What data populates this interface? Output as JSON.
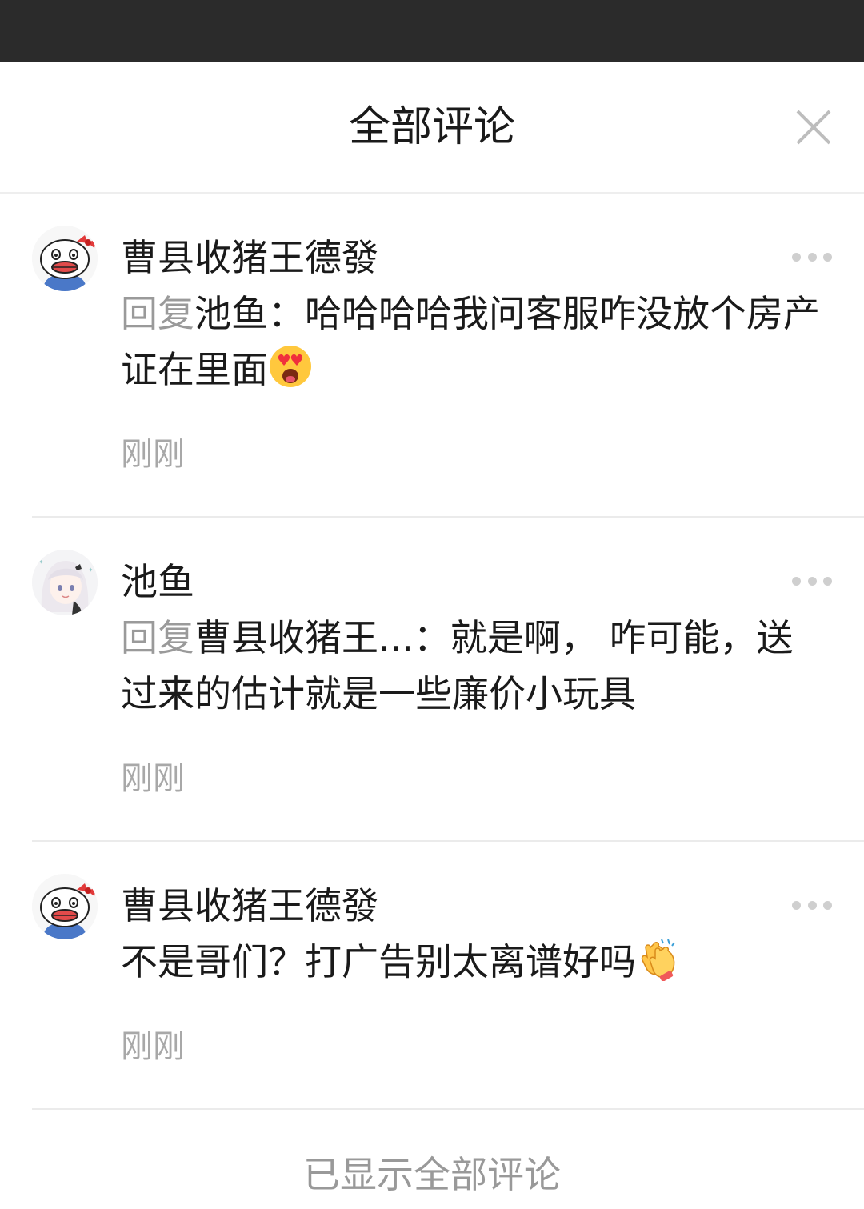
{
  "header": {
    "title": "全部评论",
    "close_icon": "close-icon"
  },
  "comments": [
    {
      "author": "曹县收猪王德發",
      "avatar": "hello-kitty-avatar",
      "reply_label": "回复",
      "reply_to": "池鱼",
      "separator": "：",
      "text": "哈哈哈哈我问客服咋没放个房产证在里面",
      "emoji": "heart-eyes-emoji",
      "time": "刚刚",
      "more_icon": "more-dots-icon"
    },
    {
      "author": "池鱼",
      "avatar": "anime-girl-avatar",
      "reply_label": "回复",
      "reply_to": "曹县收猪王...",
      "separator": "：",
      "text": "就是啊， 咋可能，送过来的估计就是一些廉价小玩具",
      "time": "刚刚",
      "more_icon": "more-dots-icon"
    },
    {
      "author": "曹县收猪王德發",
      "avatar": "hello-kitty-avatar",
      "text": "不是哥们？打广告别太离谱好吗",
      "emoji": "clapping-hands-emoji",
      "time": "刚刚",
      "more_icon": "more-dots-icon"
    }
  ],
  "footer": {
    "text": "已显示全部评论"
  }
}
